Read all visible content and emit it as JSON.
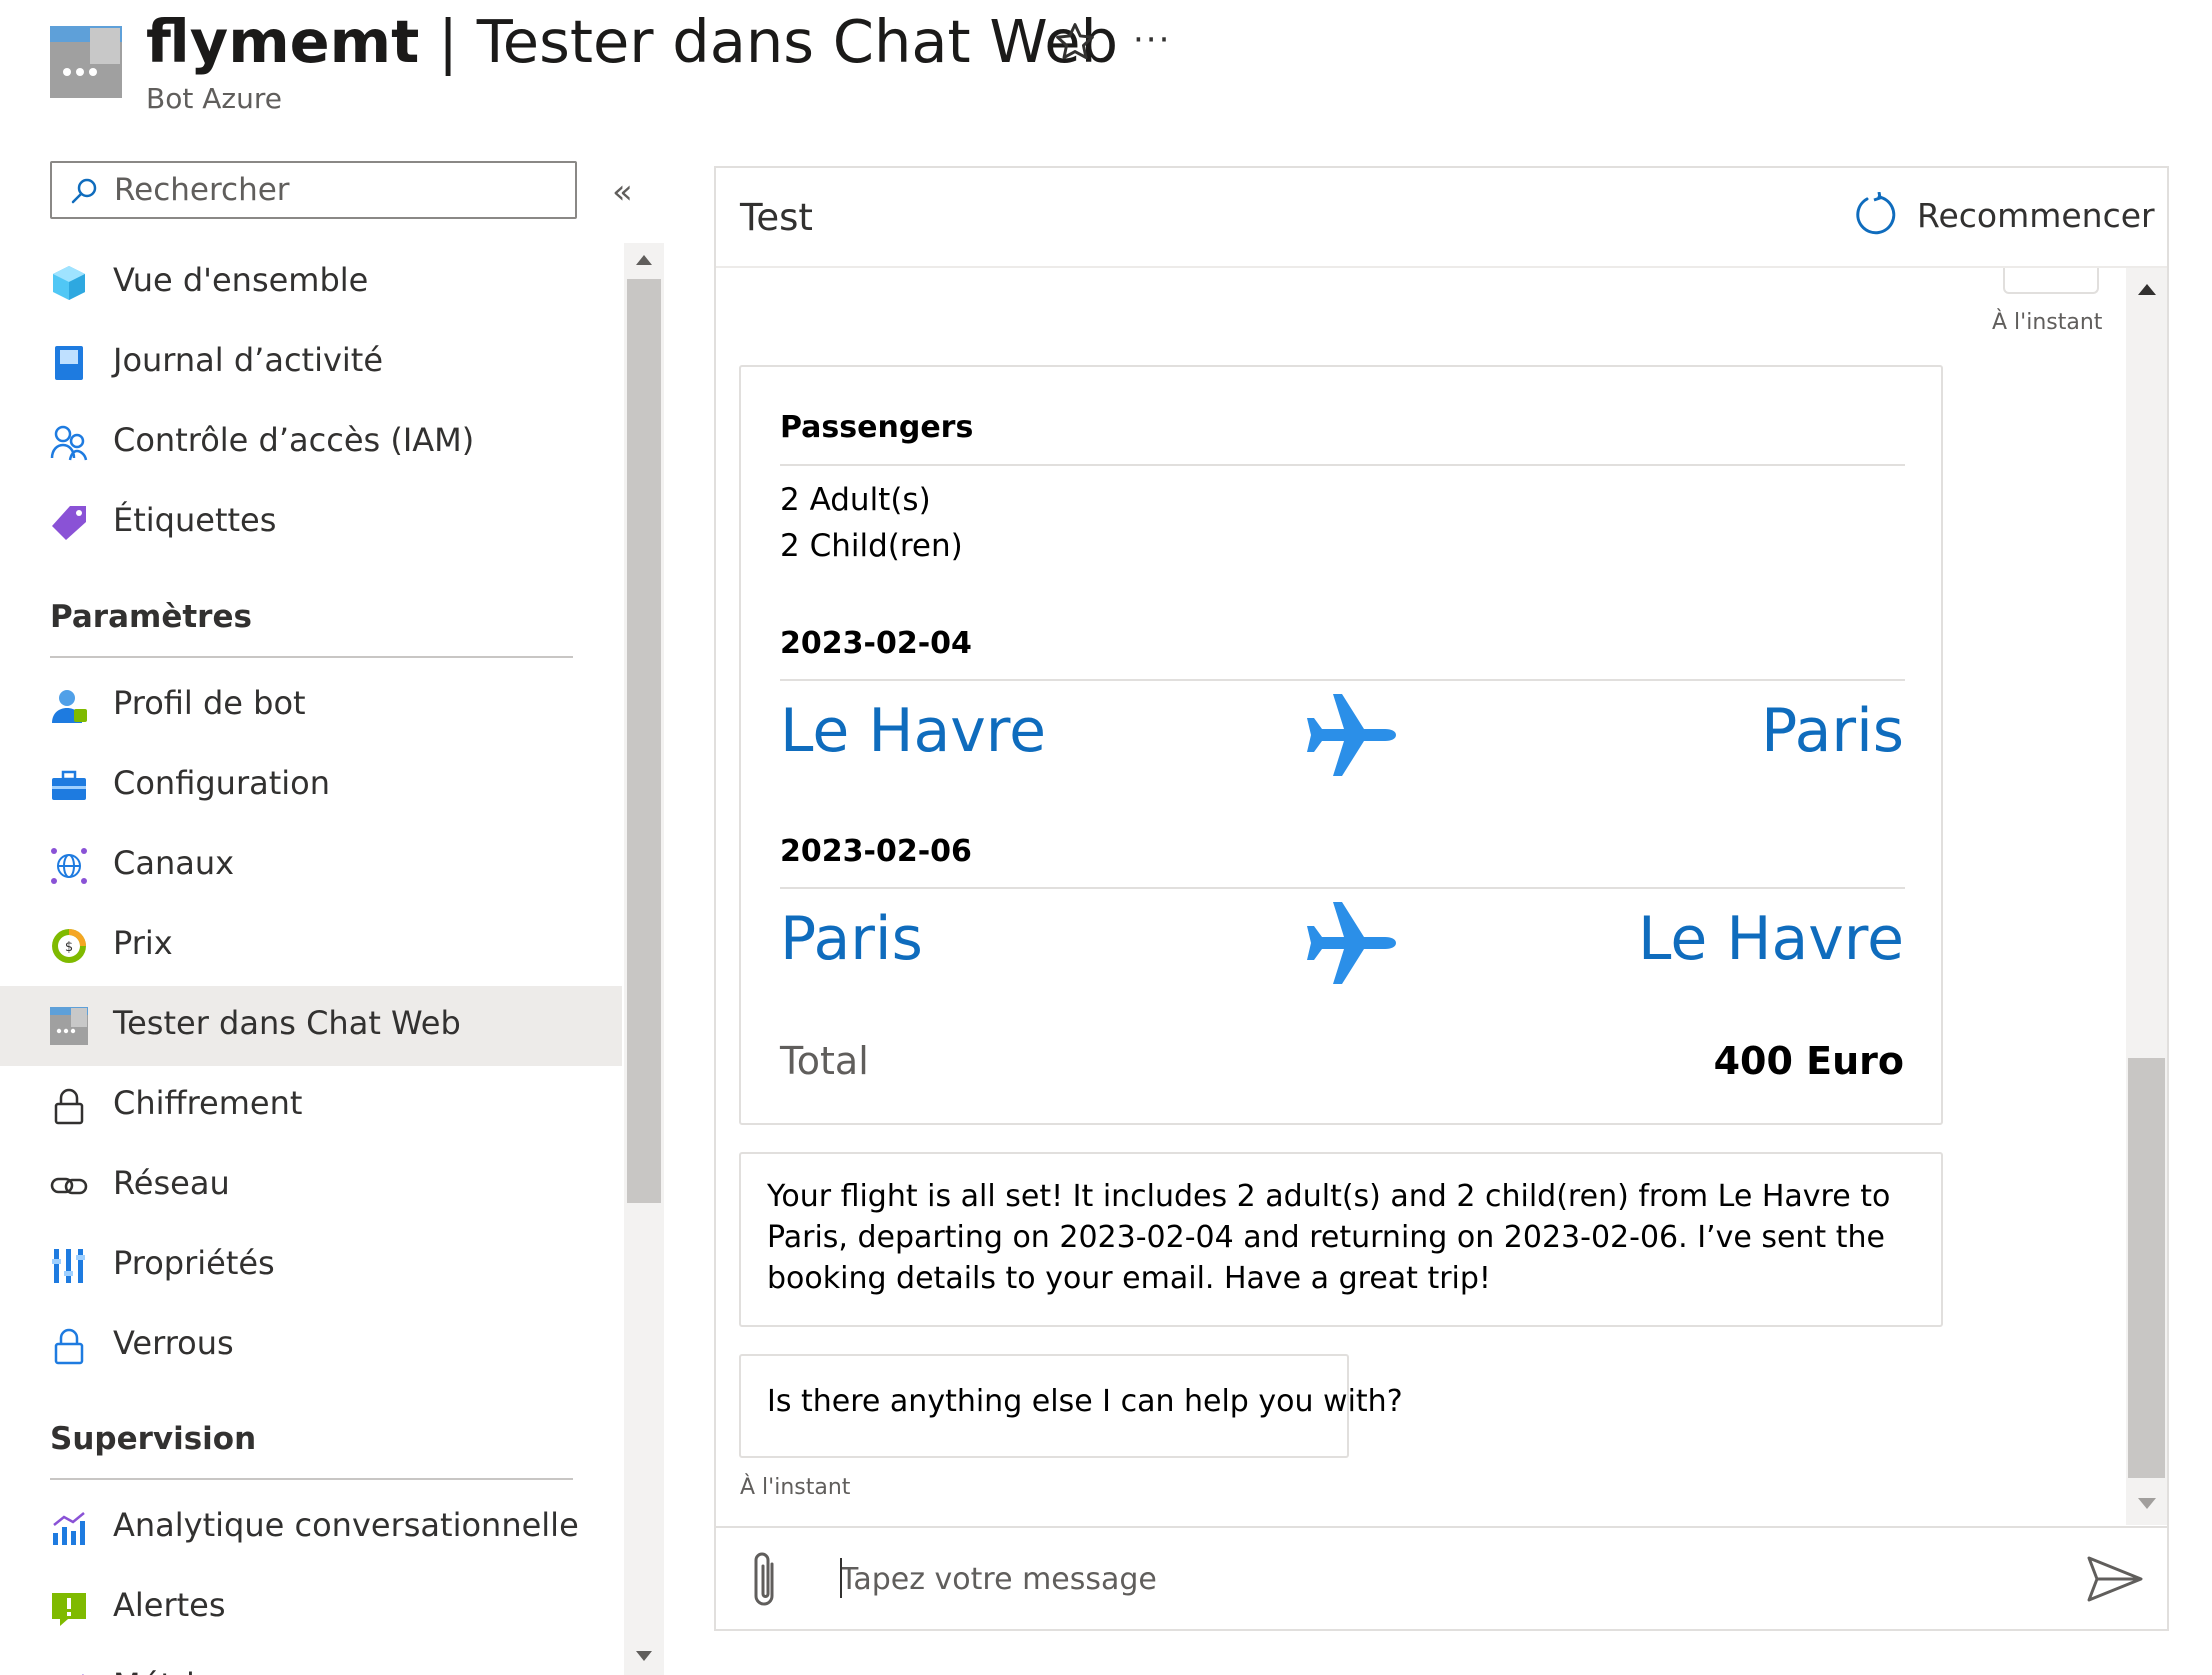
{
  "header": {
    "resource_name": "flymemt",
    "separator": "|",
    "page_name": "Tester dans Chat Web",
    "subtitle": "Bot Azure",
    "more_label": "···"
  },
  "nav": {
    "search_placeholder": "Rechercher",
    "collapse_label": "«",
    "items_top": [
      {
        "label": "Vue d'ensemble",
        "icon": "cube-icon"
      },
      {
        "label": "Journal d’activité",
        "icon": "activity-log-icon"
      },
      {
        "label": "Contrôle d’accès (IAM)",
        "icon": "people-icon"
      },
      {
        "label": "Étiquettes",
        "icon": "tag-icon"
      }
    ],
    "section_settings": "Paramètres",
    "items_settings": [
      {
        "label": "Profil de bot",
        "icon": "bot-profile-icon"
      },
      {
        "label": "Configuration",
        "icon": "toolbox-icon"
      },
      {
        "label": "Canaux",
        "icon": "globe-network-icon"
      },
      {
        "label": "Prix",
        "icon": "pricing-icon"
      },
      {
        "label": "Tester dans Chat Web",
        "icon": "webchat-icon",
        "selected": true
      },
      {
        "label": "Chiffrement",
        "icon": "lock-icon"
      },
      {
        "label": "Réseau",
        "icon": "link-icon"
      },
      {
        "label": "Propriétés",
        "icon": "properties-icon"
      },
      {
        "label": "Verrous",
        "icon": "blue-lock-icon"
      }
    ],
    "section_monitoring": "Supervision",
    "items_monitoring": [
      {
        "label": "Analytique conversationnelle",
        "icon": "analytics-icon"
      },
      {
        "label": "Alertes",
        "icon": "alert-icon"
      },
      {
        "label": "Métriques",
        "icon": "metrics-icon"
      }
    ]
  },
  "chat": {
    "title": "Test",
    "restart_label": "Recommencer",
    "timestamp": "À l'instant",
    "card": {
      "passengers_heading": "Passengers",
      "adults": "2 Adult(s)",
      "children": "2 Child(ren)",
      "outbound_date": "2023-02-04",
      "outbound_from": "Le Havre",
      "outbound_to": "Paris",
      "return_date": "2023-02-06",
      "return_from": "Paris",
      "return_to": "Le Havre",
      "total_label": "Total",
      "total_value": "400 Euro"
    },
    "message_confirm": "Your flight is all set! It includes 2 adult(s) and 2 child(ren) from Le Havre to Paris, departing on 2023-02-04 and returning on 2023-02-06. I’ve sent the booking details to your email. Have a great trip!",
    "message_followup": "Is there anything else I can help you with?",
    "input_placeholder": "Tapez votre message",
    "input_value": ""
  },
  "colors": {
    "accent": "#0f6cbd",
    "selected_bg": "#edebe9"
  }
}
